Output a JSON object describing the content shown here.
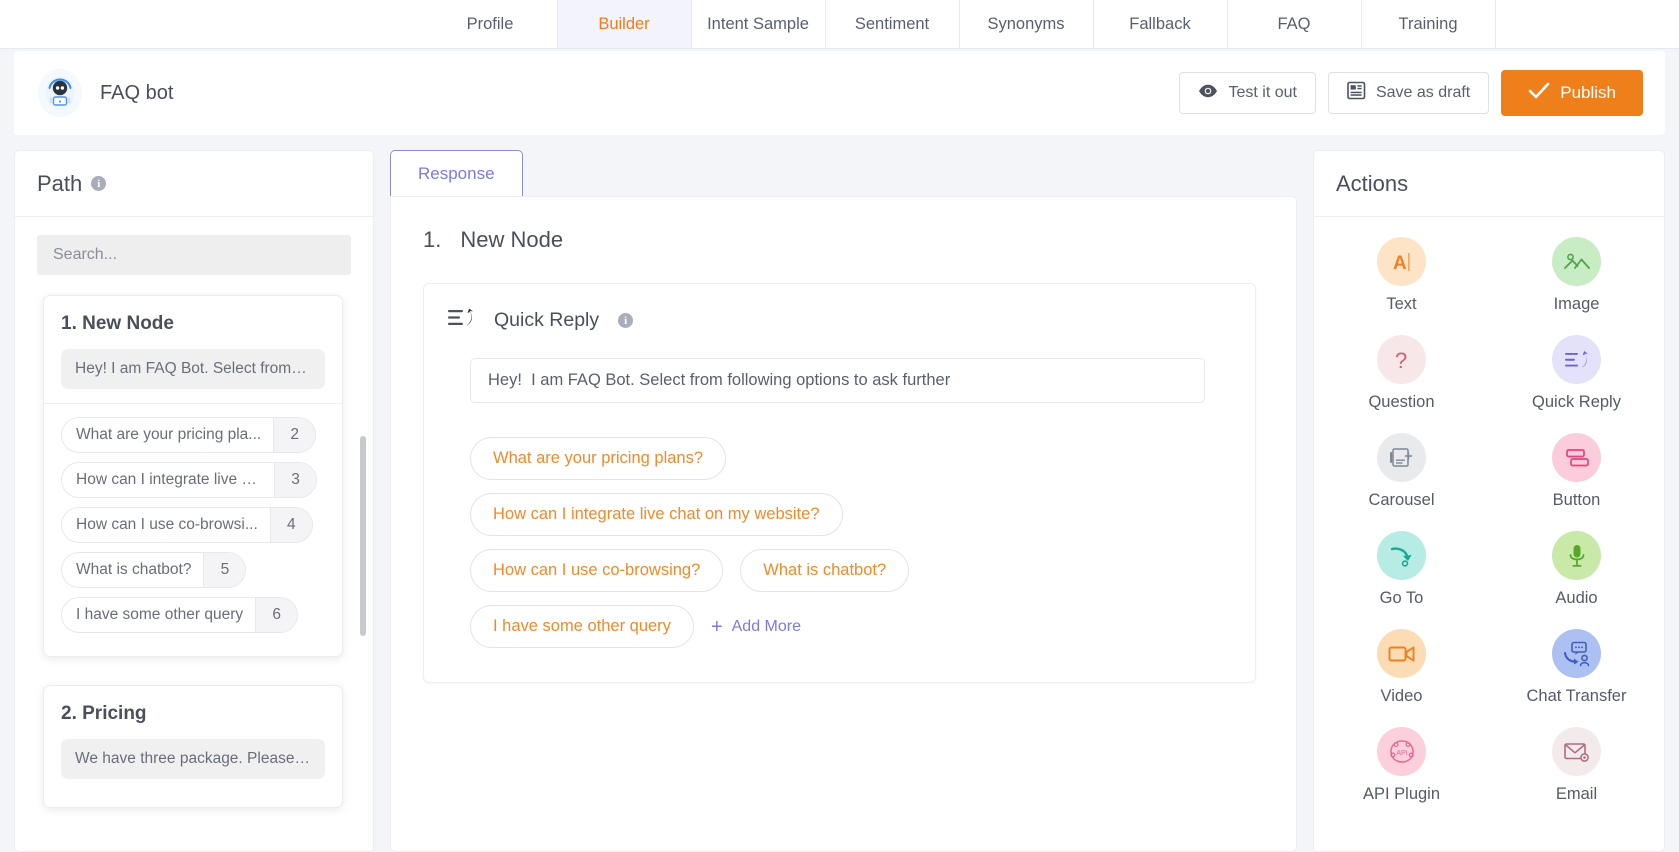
{
  "tabs": [
    {
      "label": "Profile",
      "active": false
    },
    {
      "label": "Builder",
      "active": true
    },
    {
      "label": "Intent Sample",
      "active": false
    },
    {
      "label": "Sentiment",
      "active": false
    },
    {
      "label": "Synonyms",
      "active": false
    },
    {
      "label": "Fallback",
      "active": false
    },
    {
      "label": "FAQ",
      "active": false
    },
    {
      "label": "Training",
      "active": false
    }
  ],
  "header": {
    "bot_name": "FAQ bot",
    "avatar_icon": "robot-avatar-icon",
    "test_button": "Test it out",
    "test_icon": "eye-icon",
    "save_button": "Save as draft",
    "save_icon": "save-document-icon",
    "publish_button": "Publish",
    "publish_icon": "check-icon",
    "publish_color": "#ef7f1a"
  },
  "path_panel": {
    "title": "Path",
    "info_icon": "info-icon",
    "search_placeholder": "Search...",
    "nodes": [
      {
        "title": "1. New Node",
        "message": "Hey! I am FAQ Bot. Select from f...",
        "options": [
          {
            "label": "What are your pricing pla...",
            "num": "2"
          },
          {
            "label": "How can I integrate live c...",
            "num": "3"
          },
          {
            "label": "How can I use co-browsi...",
            "num": "4"
          },
          {
            "label": "What is chatbot?",
            "num": "5"
          },
          {
            "label": "I have some other query",
            "num": "6"
          }
        ]
      },
      {
        "title": "2. Pricing",
        "message": "We have three package. Please ...",
        "options": []
      }
    ]
  },
  "center": {
    "tab_label": "Response",
    "node_number": "1.",
    "node_name": "New Node",
    "quick_reply": {
      "icon": "quick-reply-icon",
      "title": "Quick Reply",
      "info_icon": "info-icon",
      "message_value": "Hey!  I am FAQ Bot. Select from following options to ask further",
      "chips": [
        "What are your pricing plans?",
        "How can I integrate live chat on my website?",
        "How can I use co-browsing?",
        "What is chatbot?",
        "I have some other query"
      ],
      "add_more_label": "Add More",
      "add_more_icon": "plus-icon",
      "chip_color": "#f08a2a",
      "add_more_color": "#7b7be0"
    }
  },
  "actions_panel": {
    "title": "Actions",
    "items": [
      {
        "label": "Text",
        "icon": "text-letter-a-icon",
        "bg": "#fde4c6",
        "fg": "#f0802a"
      },
      {
        "label": "Image",
        "icon": "image-mountain-icon",
        "bg": "#c8ecc3",
        "fg": "#52a34a"
      },
      {
        "label": "Question",
        "icon": "question-mark-icon",
        "bg": "#f7e7e9",
        "fg": "#d4616f"
      },
      {
        "label": "Quick Reply",
        "icon": "quick-reply-icon",
        "bg": "#e4e2fb",
        "fg": "#6e63d4"
      },
      {
        "label": "Carousel",
        "icon": "carousel-card-plus-icon",
        "bg": "#e8eaec",
        "fg": "#7e8897"
      },
      {
        "label": "Button",
        "icon": "button-stack-icon",
        "bg": "#fbccdc",
        "fg": "#e8427d"
      },
      {
        "label": "Go To",
        "icon": "go-to-arrow-icon",
        "bg": "#b6ece4",
        "fg": "#17a898"
      },
      {
        "label": "Audio",
        "icon": "microphone-icon",
        "bg": "#c8e9a8",
        "fg": "#58a72c"
      },
      {
        "label": "Video",
        "icon": "video-camera-icon",
        "bg": "#fcdcb4",
        "fg": "#ee7f1d"
      },
      {
        "label": "Chat Transfer",
        "icon": "chat-transfer-icon",
        "bg": "#adc0f2",
        "fg": "#3f5fbd"
      },
      {
        "label": "API Plugin",
        "icon": "api-plugin-icon",
        "bg": "#fccfdd",
        "fg": "#e16b93"
      },
      {
        "label": "Email",
        "icon": "email-envelope-icon",
        "bg": "#f3ebeb",
        "fg": "#b06a86"
      }
    ]
  }
}
